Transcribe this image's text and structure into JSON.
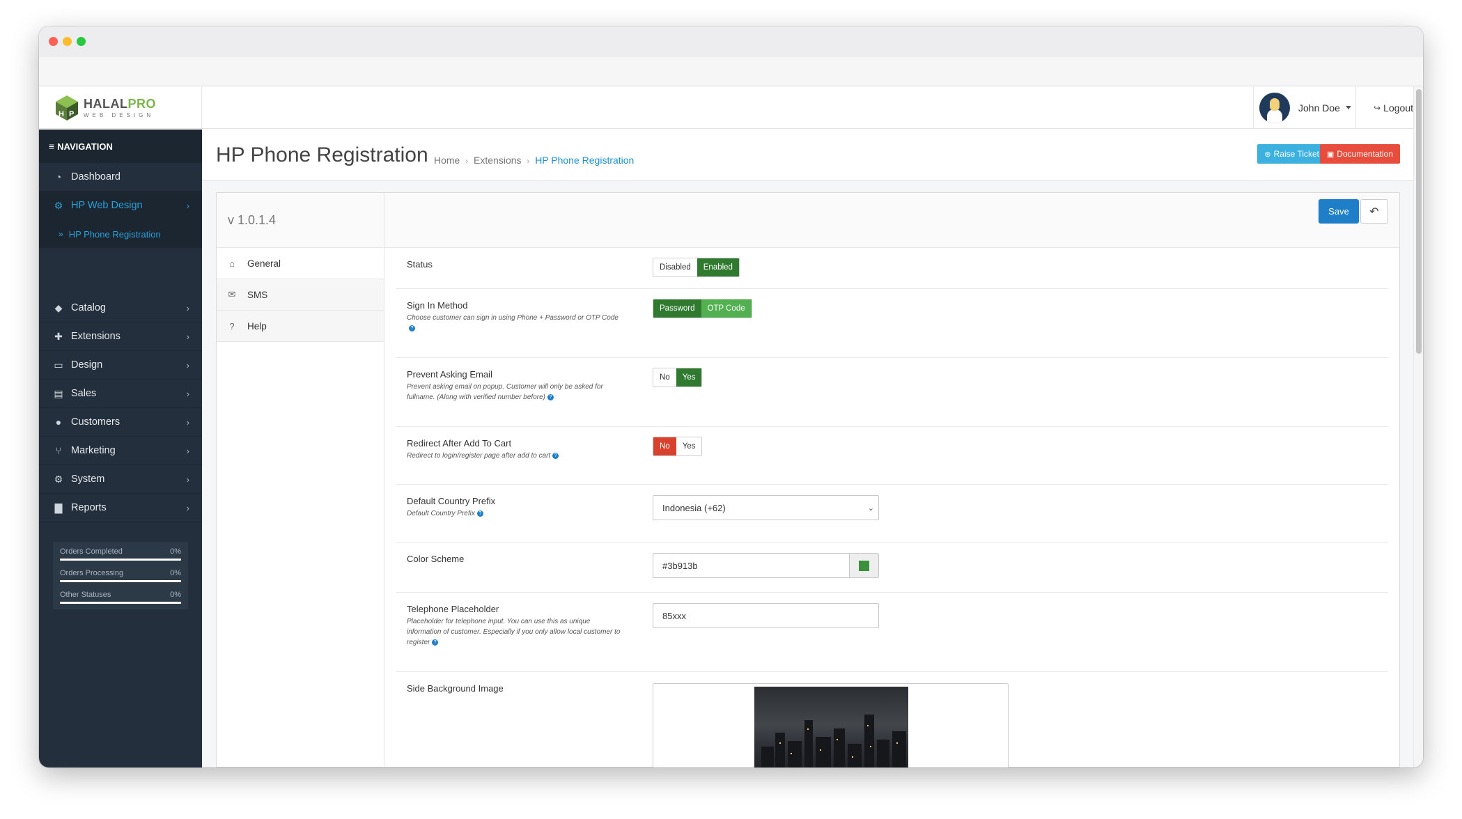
{
  "header": {
    "logo_title_a": "HALAL",
    "logo_title_b": "PRO",
    "logo_sub": "WEB DESIGN",
    "user_name": "John Doe",
    "logout_label": "Logout"
  },
  "sidebar": {
    "nav_title": "NAVIGATION",
    "items": [
      {
        "label": "Dashboard",
        "icon": "dashboard-icon"
      },
      {
        "label": "HP Web Design",
        "icon": "cogs-icon"
      },
      {
        "label": "Catalog",
        "icon": "tags-icon"
      },
      {
        "label": "Extensions",
        "icon": "puzzle-icon"
      },
      {
        "label": "Design",
        "icon": "desktop-icon"
      },
      {
        "label": "Sales",
        "icon": "cart-icon"
      },
      {
        "label": "Customers",
        "icon": "user-icon"
      },
      {
        "label": "Marketing",
        "icon": "share-icon"
      },
      {
        "label": "System",
        "icon": "gear-icon"
      },
      {
        "label": "Reports",
        "icon": "bar-chart-icon"
      }
    ],
    "sub_item": "HP Phone Registration",
    "stats": [
      {
        "label": "Orders Completed",
        "value": "0%"
      },
      {
        "label": "Orders Processing",
        "value": "0%"
      },
      {
        "label": "Other Statuses",
        "value": "0%"
      }
    ]
  },
  "page": {
    "title": "HP Phone Registration",
    "breadcrumb": [
      "Home",
      "Extensions",
      "HP Phone Registration"
    ],
    "raise_ticket": "Raise Ticket",
    "documentation": "Documentation",
    "version": "v 1.0.1.4",
    "save_label": "Save"
  },
  "tabs": [
    {
      "label": "General",
      "icon": "home-icon"
    },
    {
      "label": "SMS",
      "icon": "envelope-icon"
    },
    {
      "label": "Help",
      "icon": "question-circle-icon"
    }
  ],
  "form": {
    "status": {
      "label": "Status",
      "options": [
        "Disabled",
        "Enabled"
      ],
      "selected": "Enabled"
    },
    "sign_in": {
      "label": "Sign In Method",
      "help": "Choose customer can sign in using Phone + Password or OTP Code",
      "options": [
        "Password",
        "OTP Code"
      ]
    },
    "prevent_email": {
      "label": "Prevent Asking Email",
      "help": "Prevent asking email on popup. Customer will only be asked for fullname. (Along with verified number before)",
      "options": [
        "No",
        "Yes"
      ],
      "selected": "Yes"
    },
    "redirect": {
      "label": "Redirect After Add To Cart",
      "help": "Redirect to login/register page after add to cart",
      "options": [
        "No",
        "Yes"
      ],
      "selected": "No"
    },
    "country": {
      "label": "Default Country Prefix",
      "help": "Default Country Prefix",
      "value": "Indonesia (+62)"
    },
    "color": {
      "label": "Color Scheme",
      "value": "#3b913b",
      "swatch": "#3b913b"
    },
    "telephone": {
      "label": "Telephone Placeholder",
      "help": "Placeholder for telephone input. You can use this as unique information of customer. Especially if you only allow local customer to register",
      "value": "85xxx"
    },
    "side_bg": {
      "label": "Side Background Image"
    }
  },
  "colors": {
    "sidebar_bg": "#232f3c",
    "accent_blue": "#1e91cf",
    "green": "#3b913b",
    "red": "#d9412f"
  }
}
